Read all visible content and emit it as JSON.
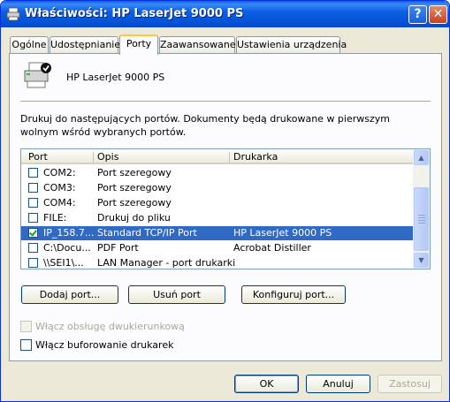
{
  "window": {
    "title": "Właściwości: HP LaserJet 9000 PS",
    "help_label": "?",
    "close_label": "✕"
  },
  "tabs": [
    {
      "label": "Ogólne"
    },
    {
      "label": "Udostępnianie"
    },
    {
      "label": "Porty"
    },
    {
      "label": "Zaawansowane"
    },
    {
      "label": "Ustawienia urządzenia"
    }
  ],
  "active_tab": "Porty",
  "printer": {
    "name": "HP LaserJet 9000 PS"
  },
  "description": "Drukuj do następujących portów. Dokumenty będą drukowane w pierwszym wolnym wśród wybranych portów.",
  "ports_table": {
    "columns": [
      "Port",
      "Opis",
      "Drukarka"
    ],
    "rows": [
      {
        "checked": false,
        "port": "COM2:",
        "desc": "Port szeregowy",
        "printer": "",
        "selected": false
      },
      {
        "checked": false,
        "port": "COM3:",
        "desc": "Port szeregowy",
        "printer": "",
        "selected": false
      },
      {
        "checked": false,
        "port": "COM4:",
        "desc": "Port szeregowy",
        "printer": "",
        "selected": false
      },
      {
        "checked": false,
        "port": "FILE:",
        "desc": "Drukuj do pliku",
        "printer": "",
        "selected": false
      },
      {
        "checked": true,
        "port": "IP_158.7...",
        "desc": "Standard TCP/IP Port",
        "printer": "HP LaserJet 9000 PS",
        "selected": true
      },
      {
        "checked": false,
        "port": "C:\\Docu...",
        "desc": "PDF Port",
        "printer": "Acrobat Distiller",
        "selected": false
      },
      {
        "checked": false,
        "port": "\\\\SEI1\\...",
        "desc": "LAN Manager - port drukarki",
        "printer": "",
        "selected": false
      }
    ]
  },
  "port_buttons": {
    "add": "Dodaj port...",
    "delete": "Usuń port",
    "configure": "Konfiguruj port..."
  },
  "options": {
    "bidirectional": {
      "label": "Włącz obsługę dwukierunkową",
      "checked": false,
      "enabled": false
    },
    "pooling": {
      "label": "Włącz buforowanie drukarek",
      "checked": false,
      "enabled": true
    }
  },
  "dialog_buttons": {
    "ok": "OK",
    "cancel": "Anuluj",
    "apply": "Zastosuj"
  }
}
